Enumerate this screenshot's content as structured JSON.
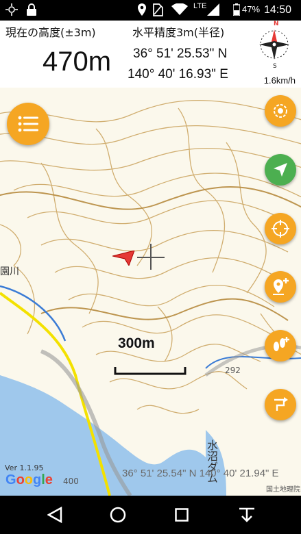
{
  "status_bar": {
    "battery_percent": "47%",
    "time": "14:50",
    "network": "LTE",
    "icons": [
      "gps-searching-icon",
      "lock-icon",
      "location-pin-icon",
      "no-sim-icon",
      "wifi-icon",
      "signal-icon",
      "battery-icon"
    ]
  },
  "info_panel": {
    "altitude_label": "現在の高度(±3m)",
    "accuracy_label": "水平精度3m(半径)",
    "altitude_value": "470m",
    "latitude": "36° 51' 25.53\" N",
    "longitude": "140° 40' 16.93\" E",
    "speed": "1.6km/h",
    "compass": {
      "north": "N",
      "south": "S",
      "icon": "compass-icon"
    }
  },
  "map": {
    "scale_label": "300m",
    "center_coordinates": "36° 51' 25.54\" N 140° 40' 21.94\" E",
    "version": "Ver 1.1.95",
    "google_logo": "Google",
    "attribution": "国土地理院",
    "place_label": "水沼ダム",
    "elevation_labels": [
      "400",
      "292"
    ],
    "river_label": "園川",
    "colors": {
      "contour": "#c9a15a",
      "water": "#9fc8ec",
      "accent": "#f5a623",
      "go": "#4caf50",
      "arrow": "#e53935"
    }
  },
  "buttons": {
    "menu": "menu-icon",
    "right": [
      "layer-icon",
      "navigate-icon",
      "crosshair-icon",
      "add-pin-icon",
      "footsteps-icon",
      "route-icon"
    ]
  },
  "nav_bar": {
    "icons": [
      "back-icon",
      "home-icon",
      "recents-icon",
      "download-icon"
    ]
  }
}
